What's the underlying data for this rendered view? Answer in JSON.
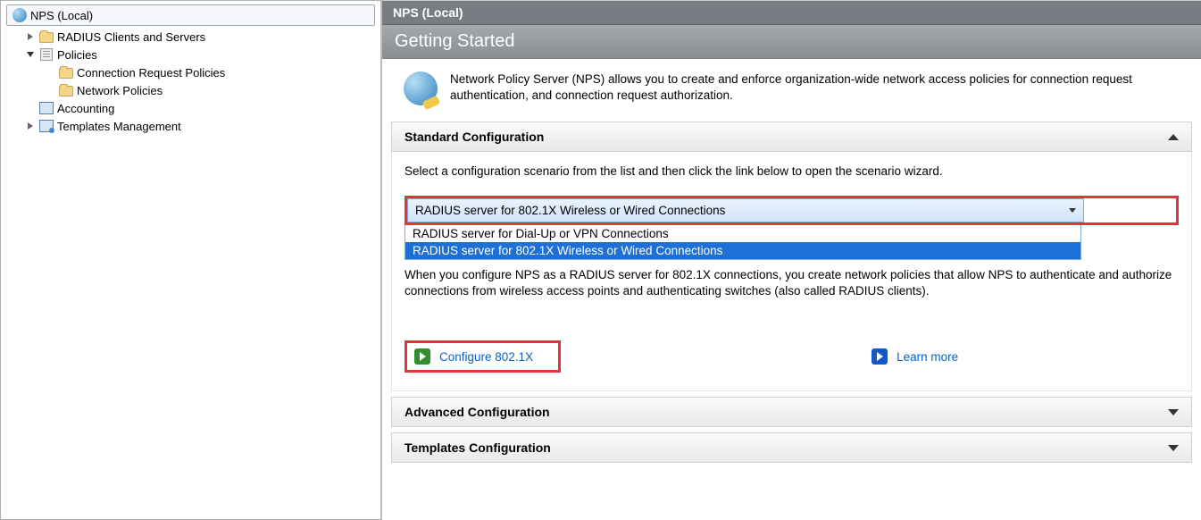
{
  "tree": {
    "root": "NPS (Local)",
    "radius": "RADIUS Clients and Servers",
    "policies": "Policies",
    "crp": "Connection Request Policies",
    "np": "Network Policies",
    "acct": "Accounting",
    "templ": "Templates Management"
  },
  "content": {
    "title": "NPS (Local)",
    "header": "Getting Started",
    "intro": "Network Policy Server (NPS) allows you to create and enforce organization-wide network access policies for connection request authentication, and connection request authorization.",
    "std_hdr": "Standard Configuration",
    "scenario_prompt": "Select a configuration scenario from the list and then click the link below to open the scenario wizard.",
    "combo_selected": "RADIUS server for 802.1X Wireless or Wired Connections",
    "combo_opt1": "RADIUS server for Dial-Up or VPN Connections",
    "combo_opt2": "RADIUS server for 802.1X Wireless or Wired Connections",
    "desc": "When you configure NPS as a RADIUS server for 802.1X connections, you create network policies that allow NPS to authenticate and authorize connections from wireless access points and authenticating switches (also called RADIUS clients).",
    "configure_link": "Configure 802.1X",
    "learn_link": "Learn more",
    "adv_hdr": "Advanced Configuration",
    "tmpl_hdr": "Templates Configuration"
  }
}
